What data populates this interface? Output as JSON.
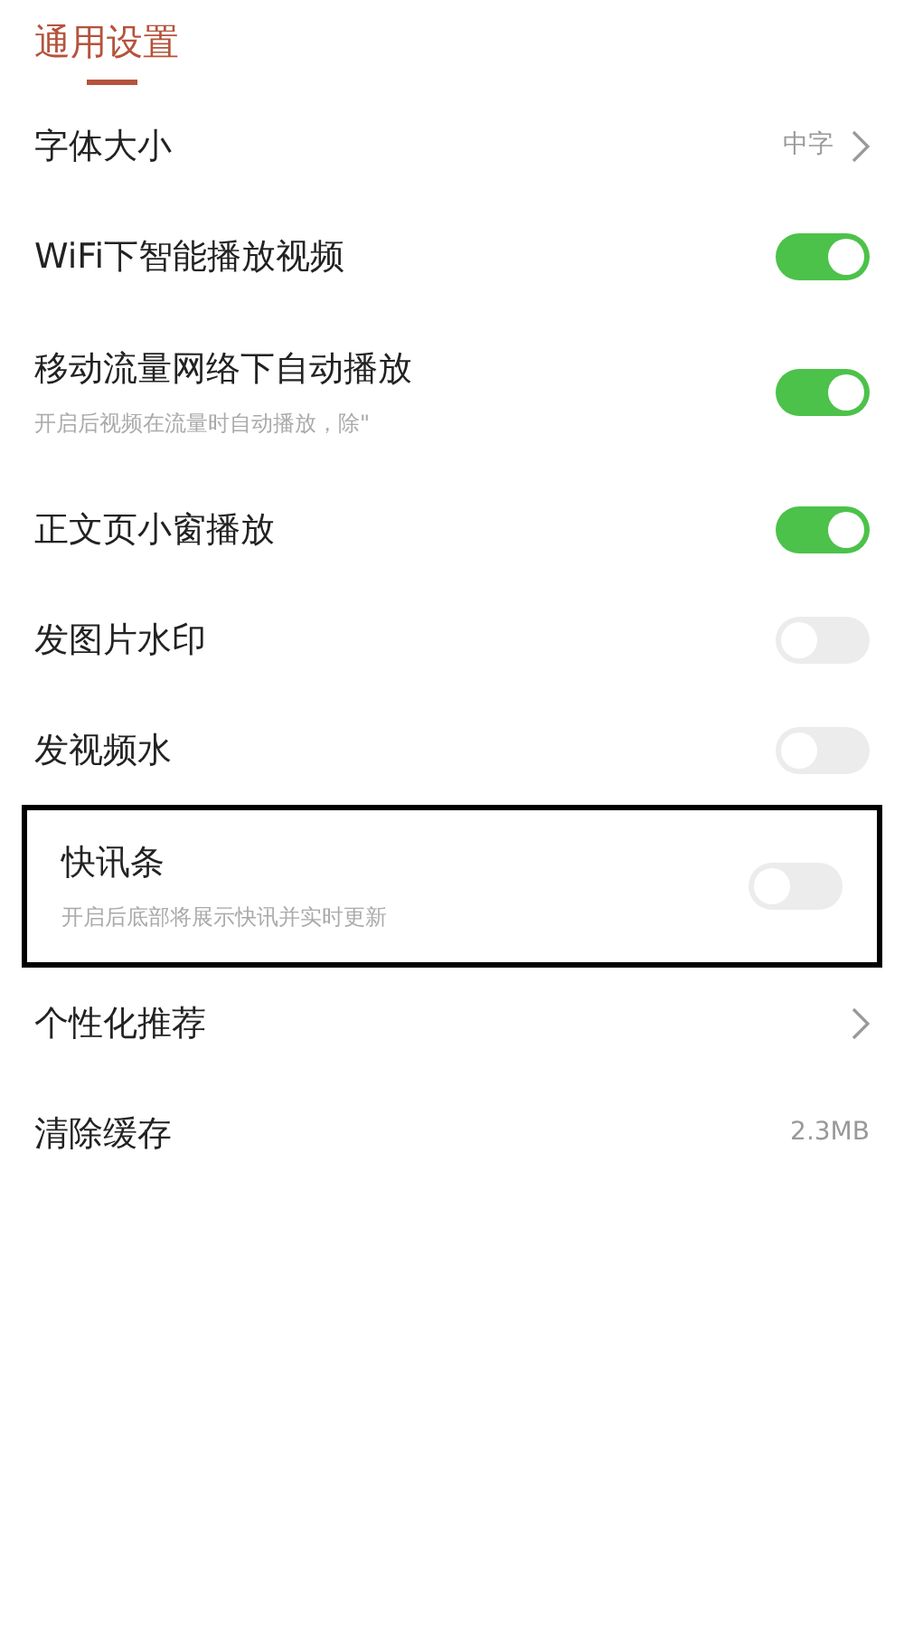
{
  "header": {
    "title": "通用设置"
  },
  "settings": [
    {
      "kind": "link",
      "label": "字体大小",
      "value": "中字"
    },
    {
      "kind": "toggle",
      "label": "WiFi下智能播放视频",
      "on": true
    },
    {
      "kind": "toggle",
      "label": "移动流量网络下自动播放",
      "description": "开启后视频在流量时自动播放，除\"",
      "on": true
    },
    {
      "kind": "toggle",
      "label": "正文页小窗播放",
      "on": true
    },
    {
      "kind": "toggle",
      "label": "发图片水印",
      "on": false
    },
    {
      "kind": "toggle",
      "label": "发视频水",
      "on": false
    },
    {
      "kind": "toggle",
      "label": "快讯条",
      "description": "开启后底部将展示快讯并实时更新",
      "on": false,
      "highlighted": true
    },
    {
      "kind": "link",
      "label": "个性化推荐"
    },
    {
      "kind": "value",
      "label": "清除缓存",
      "value": "2.3MB"
    }
  ]
}
